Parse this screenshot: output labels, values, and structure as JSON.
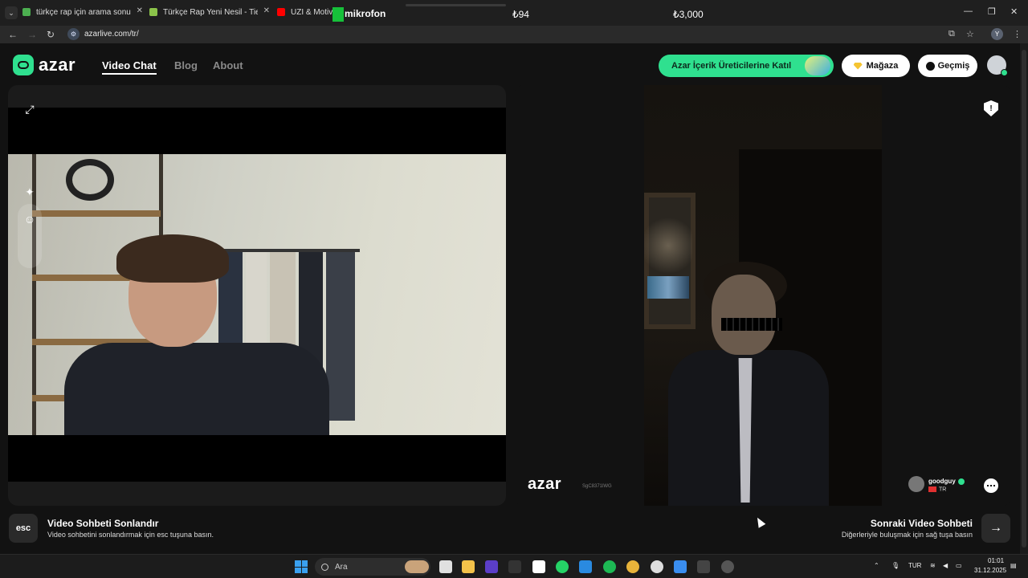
{
  "browser": {
    "tabs": [
      {
        "title": "türkçe rap için arama sonuçları",
        "favicon_color": "#4caf50"
      },
      {
        "title": "Türkçe Rap Yeni Nesil - Tier List",
        "favicon_color": "#8bc34a"
      },
      {
        "title": "UZI & Motive",
        "favicon_color": "#ff0000"
      }
    ],
    "url": "azarlive.com/tr/",
    "profile_initial": "Y"
  },
  "stream_overlay": {
    "mic_label": "mikrofon",
    "value_left": "₺94",
    "value_right": "₺3,000"
  },
  "header": {
    "logo_text": "azar",
    "nav": [
      {
        "label": "Video Chat",
        "active": true
      },
      {
        "label": "Blog",
        "active": false
      },
      {
        "label": "About",
        "active": false
      }
    ],
    "creator_button": "Azar İçerik Üreticilerine Katıl",
    "store_button": "Mağaza",
    "history_button": "Geçmiş"
  },
  "remote": {
    "watermark": "azar",
    "session_id": "SgC8371lWG",
    "peer_name": "goodguy",
    "peer_country": "TR"
  },
  "actions": {
    "end_key": "esc",
    "end_title": "Video Sohbeti Sonlandır",
    "end_desc": "Video sohbetini sonlandırmak için esc tuşuna basın.",
    "next_title": "Sonraki Video Sohbeti",
    "next_desc": "Diğerleriyle buluşmak için sağ tuşa basın",
    "next_arrow": "→"
  },
  "taskbar": {
    "search_placeholder": "Ara",
    "language": "TUR",
    "time": "01:01",
    "date": "31.12.2025"
  }
}
